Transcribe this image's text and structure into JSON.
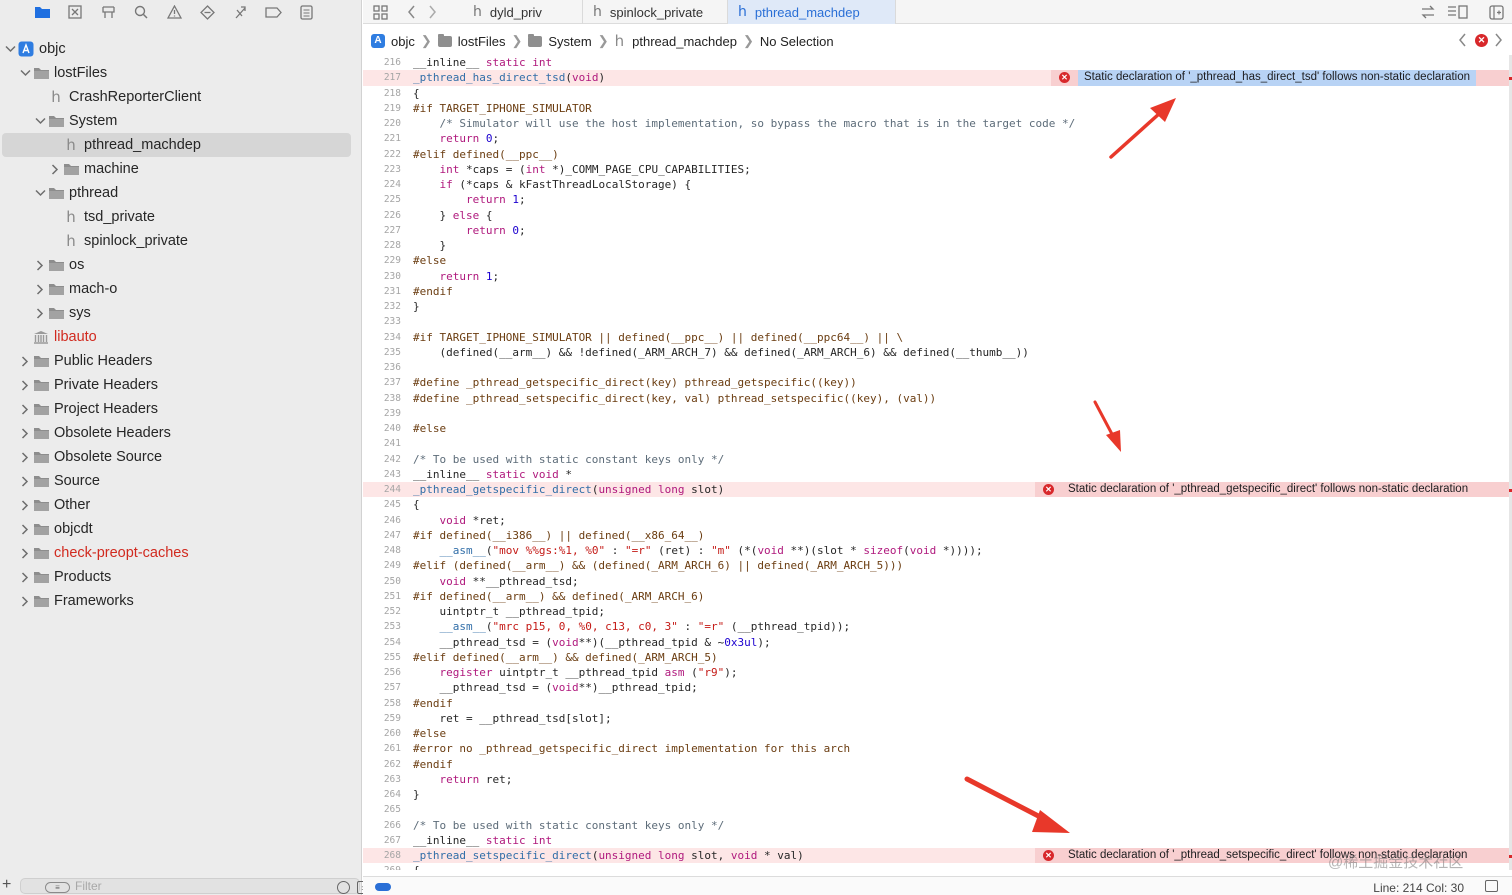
{
  "navigator": {
    "toolbar_icons": [
      "folder-icon",
      "source-control-icon",
      "symbol-icon",
      "find-icon",
      "issue-icon",
      "test-icon",
      "debug-icon",
      "breakpoint-icon",
      "report-icon"
    ],
    "tree": [
      {
        "label": "objc",
        "icon": "project",
        "expanded": true
      },
      {
        "label": "lostFiles",
        "icon": "folder",
        "expanded": true
      },
      {
        "label": "CrashReporterClient",
        "icon": "header"
      },
      {
        "label": "System",
        "icon": "folder",
        "expanded": true
      },
      {
        "label": "pthread_machdep",
        "icon": "header",
        "selected": true
      },
      {
        "label": "machine",
        "icon": "folder",
        "expanded": false
      },
      {
        "label": "pthread",
        "icon": "folder",
        "expanded": true
      },
      {
        "label": "tsd_private",
        "icon": "header"
      },
      {
        "label": "spinlock_private",
        "icon": "header"
      },
      {
        "label": "os",
        "icon": "folder",
        "expanded": false
      },
      {
        "label": "mach-o",
        "icon": "folder",
        "expanded": false
      },
      {
        "label": "sys",
        "icon": "folder",
        "expanded": false
      },
      {
        "label": "libauto",
        "icon": "library",
        "missing": true
      },
      {
        "label": "Public Headers",
        "icon": "folder",
        "expanded": false
      },
      {
        "label": "Private Headers",
        "icon": "folder",
        "expanded": false
      },
      {
        "label": "Project Headers",
        "icon": "folder",
        "expanded": false
      },
      {
        "label": "Obsolete Headers",
        "icon": "folder",
        "expanded": false
      },
      {
        "label": "Obsolete Source",
        "icon": "folder",
        "expanded": false
      },
      {
        "label": "Source",
        "icon": "folder",
        "expanded": false
      },
      {
        "label": "Other",
        "icon": "folder",
        "expanded": false
      },
      {
        "label": "objcdt",
        "icon": "folder",
        "expanded": false
      },
      {
        "label": "check-preopt-caches",
        "icon": "folder",
        "expanded": false,
        "missing": true
      },
      {
        "label": "Products",
        "icon": "folder",
        "expanded": false
      },
      {
        "label": "Frameworks",
        "icon": "folder",
        "expanded": false
      }
    ],
    "filter": {
      "placeholder": "Filter"
    }
  },
  "tabs": [
    {
      "label": "dyld_priv",
      "active": false
    },
    {
      "label": "spinlock_private",
      "active": false
    },
    {
      "label": "pthread_machdep",
      "active": true
    }
  ],
  "jumpbar": {
    "crumbs": [
      "objc",
      "lostFiles",
      "System",
      "pthread_machdep",
      "No Selection"
    ]
  },
  "code": {
    "lines": [
      {
        "n": "216",
        "t": "__inline__ static int"
      },
      {
        "n": "217",
        "t": "_pthread_has_direct_tsd(void)",
        "error": "Static declaration of '_pthread_has_direct_tsd' follows non-static declaration",
        "error_selected": true
      },
      {
        "n": "218",
        "t": "{"
      },
      {
        "n": "219",
        "t": "#if TARGET_IPHONE_SIMULATOR"
      },
      {
        "n": "220",
        "t": "    /* Simulator will use the host implementation, so bypass the macro that is in the target code */"
      },
      {
        "n": "221",
        "t": "    return 0;"
      },
      {
        "n": "222",
        "t": "#elif defined(__ppc__)"
      },
      {
        "n": "223",
        "t": "    int *caps = (int *)_COMM_PAGE_CPU_CAPABILITIES;"
      },
      {
        "n": "224",
        "t": "    if (*caps & kFastThreadLocalStorage) {"
      },
      {
        "n": "225",
        "t": "        return 1;"
      },
      {
        "n": "226",
        "t": "    } else {"
      },
      {
        "n": "227",
        "t": "        return 0;"
      },
      {
        "n": "228",
        "t": "    }"
      },
      {
        "n": "229",
        "t": "#else"
      },
      {
        "n": "230",
        "t": "    return 1;"
      },
      {
        "n": "231",
        "t": "#endif"
      },
      {
        "n": "232",
        "t": "}"
      },
      {
        "n": "233",
        "t": ""
      },
      {
        "n": "234",
        "t": "#if TARGET_IPHONE_SIMULATOR || defined(__ppc__) || defined(__ppc64__) || \\"
      },
      {
        "n": "235",
        "t": "    (defined(__arm__) && !defined(_ARM_ARCH_7) && defined(_ARM_ARCH_6) && defined(__thumb__))"
      },
      {
        "n": "236",
        "t": ""
      },
      {
        "n": "237",
        "t": "#define _pthread_getspecific_direct(key) pthread_getspecific((key))"
      },
      {
        "n": "238",
        "t": "#define _pthread_setspecific_direct(key, val) pthread_setspecific((key), (val))"
      },
      {
        "n": "239",
        "t": ""
      },
      {
        "n": "240",
        "t": "#else"
      },
      {
        "n": "241",
        "t": ""
      },
      {
        "n": "242",
        "t": "/* To be used with static constant keys only */"
      },
      {
        "n": "243",
        "t": "__inline__ static void *"
      },
      {
        "n": "244",
        "t": "_pthread_getspecific_direct(unsigned long slot)",
        "error": "Static declaration of '_pthread_getspecific_direct' follows non-static declaration"
      },
      {
        "n": "245",
        "t": "{"
      },
      {
        "n": "246",
        "t": "    void *ret;"
      },
      {
        "n": "247",
        "t": "#if defined(__i386__) || defined(__x86_64__)"
      },
      {
        "n": "248",
        "t": "    __asm__(\"mov %%gs:%1, %0\" : \"=r\" (ret) : \"m\" (*(void **)(slot * sizeof(void *))));"
      },
      {
        "n": "249",
        "t": "#elif (defined(__arm__) && (defined(_ARM_ARCH_6) || defined(_ARM_ARCH_5)))"
      },
      {
        "n": "250",
        "t": "    void **__pthread_tsd;"
      },
      {
        "n": "251",
        "t": "#if defined(__arm__) && defined(_ARM_ARCH_6)"
      },
      {
        "n": "252",
        "t": "    uintptr_t __pthread_tpid;"
      },
      {
        "n": "253",
        "t": "    __asm__(\"mrc p15, 0, %0, c13, c0, 3\" : \"=r\" (__pthread_tpid));"
      },
      {
        "n": "254",
        "t": "    __pthread_tsd = (void**)(__pthread_tpid & ~0x3ul);"
      },
      {
        "n": "255",
        "t": "#elif defined(__arm__) && defined(_ARM_ARCH_5)"
      },
      {
        "n": "256",
        "t": "    register uintptr_t __pthread_tpid asm (\"r9\");"
      },
      {
        "n": "257",
        "t": "    __pthread_tsd = (void**)__pthread_tpid;"
      },
      {
        "n": "258",
        "t": "#endif"
      },
      {
        "n": "259",
        "t": "    ret = __pthread_tsd[slot];"
      },
      {
        "n": "260",
        "t": "#else"
      },
      {
        "n": "261",
        "t": "#error no _pthread_getspecific_direct implementation for this arch"
      },
      {
        "n": "262",
        "t": "#endif"
      },
      {
        "n": "263",
        "t": "    return ret;"
      },
      {
        "n": "264",
        "t": "}"
      },
      {
        "n": "265",
        "t": ""
      },
      {
        "n": "266",
        "t": "/* To be used with static constant keys only */"
      },
      {
        "n": "267",
        "t": "__inline__ static int"
      },
      {
        "n": "268",
        "t": "_pthread_setspecific_direct(unsigned long slot, void * val)",
        "error": "Static declaration of '_pthread_setspecific_direct' follows non-static declaration"
      },
      {
        "n": "269",
        "t": "{"
      }
    ]
  },
  "status": {
    "position": "Line: 214  Col: 30"
  },
  "watermark": "@稀土掘金技术社区",
  "colors": {
    "accent": "#2a6fd6",
    "error_line": "#fde6e6",
    "error_banner": "#f8cfd0",
    "error_badge": "#d8282b",
    "missing_file": "#d12a1f",
    "annotation_arrow": "#e8382a"
  }
}
